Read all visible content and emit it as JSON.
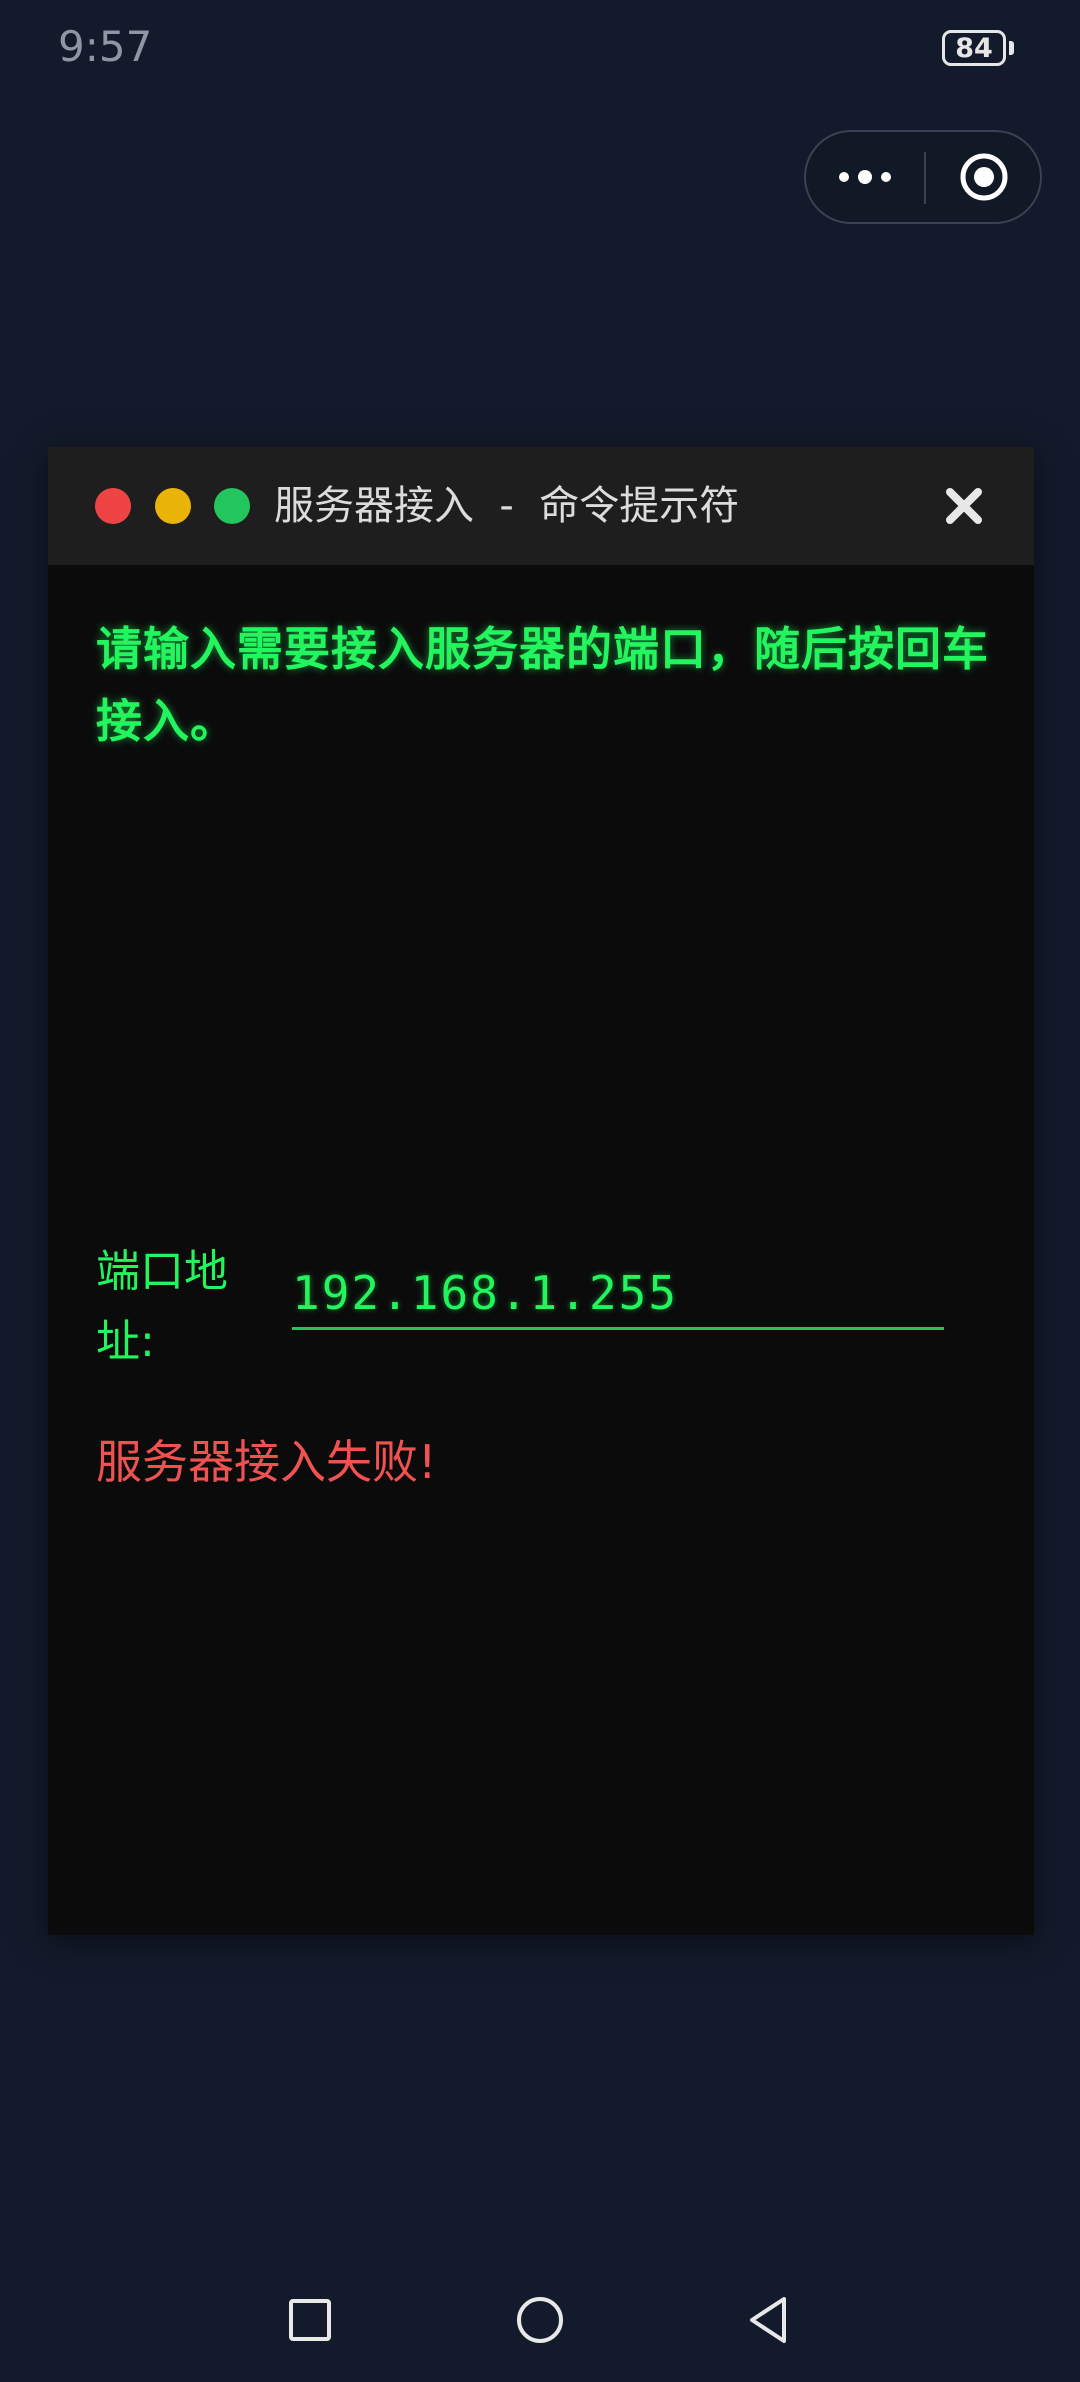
{
  "status_bar": {
    "time": "9:57",
    "battery": "84"
  },
  "capsule": {
    "more_icon": "more-dots-icon",
    "close_icon": "target-circle-icon"
  },
  "window": {
    "title": "服务器接入  -  命令提示符",
    "close_icon": "close-x-icon",
    "traffic_lights": [
      "#ef4444",
      "#eab308",
      "#22c55e"
    ]
  },
  "terminal": {
    "prompt": "请输入需要接入服务器的端口，随后按回车接入。",
    "port_label": "端口地址:",
    "port_value": "192.168.1.255",
    "error": "服务器接入失败!"
  },
  "colors": {
    "background": "#131a2b",
    "terminal_bg": "#0b0b0b",
    "titlebar_bg": "#1e1e1e",
    "green_text": "#22f55e",
    "error_text": "#f05252"
  },
  "navbar": {
    "recent_icon": "square-icon",
    "home_icon": "circle-icon",
    "back_icon": "triangle-back-icon"
  }
}
